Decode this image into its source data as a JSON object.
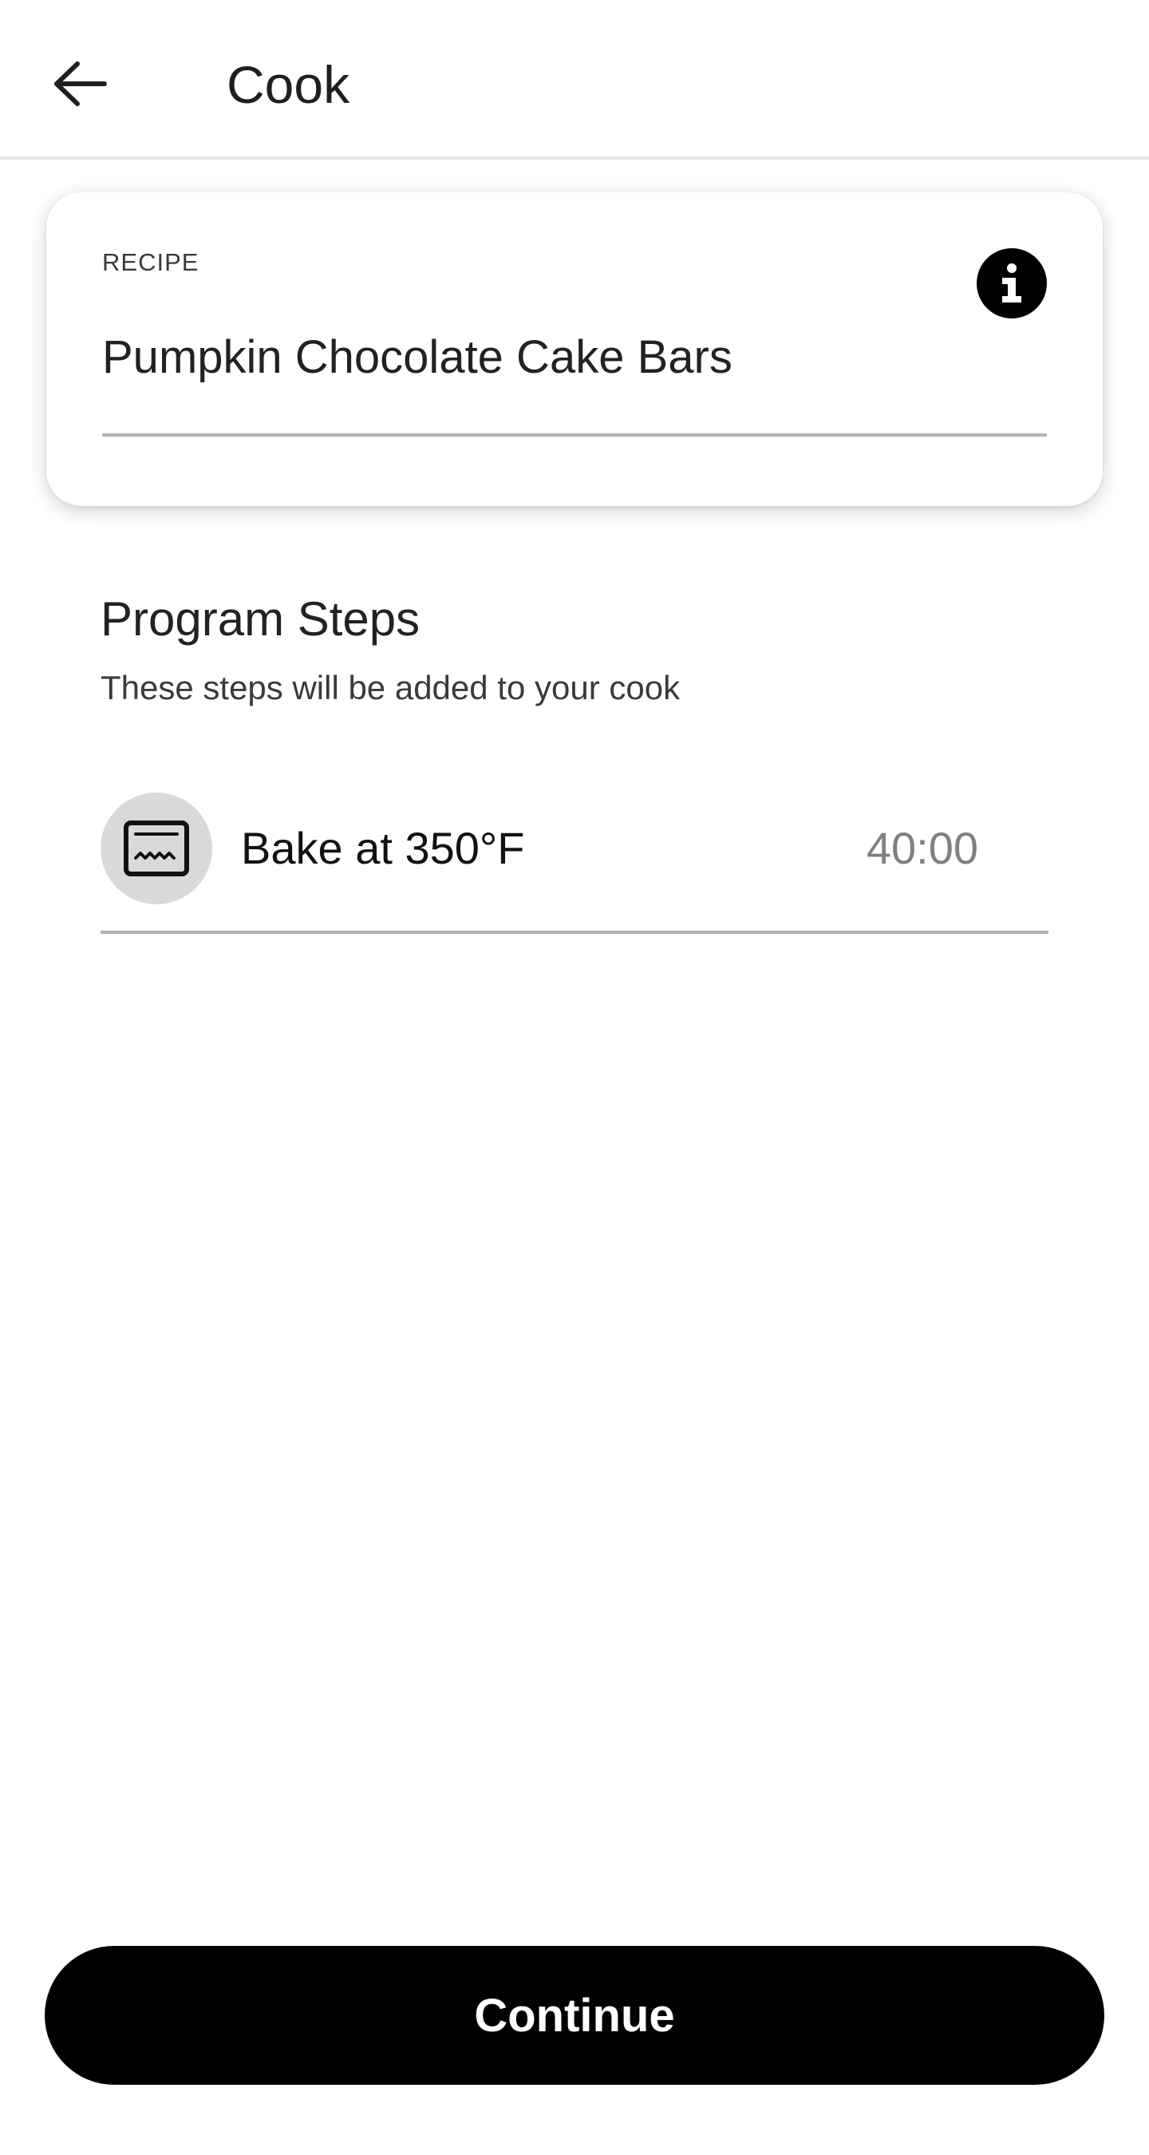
{
  "header": {
    "title": "Cook",
    "back_icon": "arrow-left-icon"
  },
  "recipe_card": {
    "label": "RECIPE",
    "name": "Pumpkin Chocolate Cake Bars",
    "info_icon": "info-icon"
  },
  "program_steps": {
    "title": "Program Steps",
    "subtitle": "These steps will be added to your cook",
    "steps": [
      {
        "icon": "oven-icon",
        "label": "Bake at 350°F",
        "time": "40:00"
      }
    ]
  },
  "footer": {
    "continue_label": "Continue"
  },
  "colors": {
    "primary": "#000000",
    "divider": "#b3b3b3",
    "muted_text": "#808080",
    "icon_bg": "#d9d9d9"
  }
}
